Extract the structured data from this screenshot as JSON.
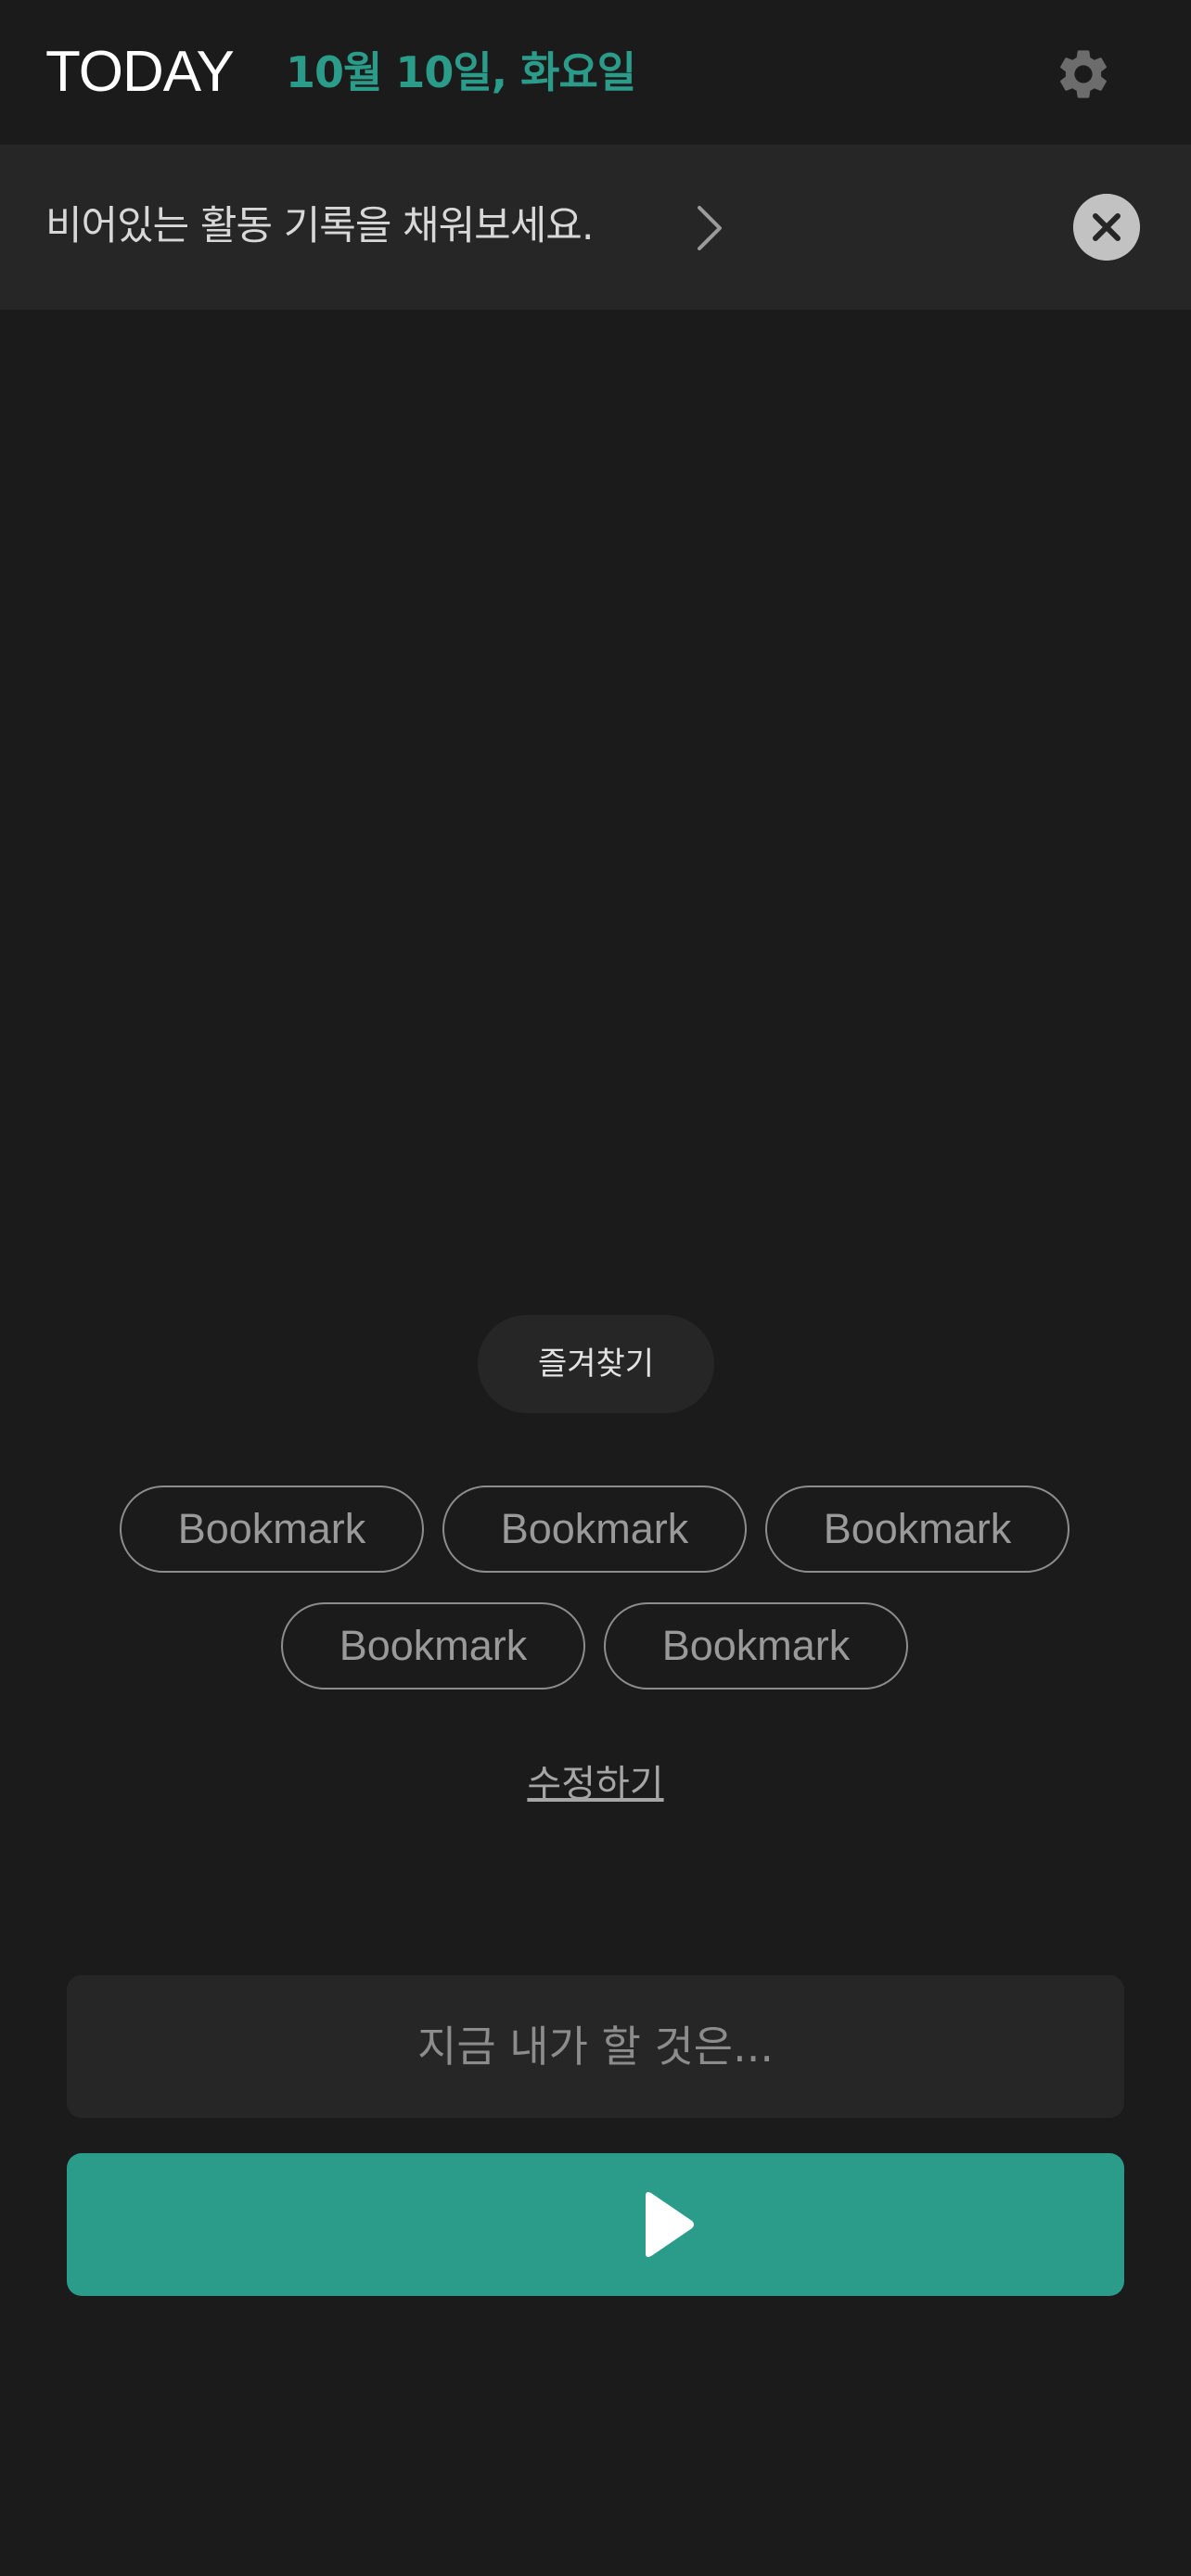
{
  "header": {
    "title": "TODAY",
    "date": "10월 10일, 화요일",
    "settings_icon": "gear-icon"
  },
  "banner": {
    "text": "비어있는 활동 기록을 채워보세요.",
    "chevron_icon": "chevron-right-icon",
    "close_icon": "close-icon"
  },
  "favorites": {
    "label": "즐겨찾기",
    "bookmarks": [
      "Bookmark",
      "Bookmark",
      "Bookmark",
      "Bookmark",
      "Bookmark"
    ],
    "edit_label": "수정하기"
  },
  "task": {
    "placeholder": "지금 내가 할 것은...",
    "play_icon": "play-icon"
  },
  "colors": {
    "background": "#1b1b1b",
    "surface": "#262626",
    "accent": "#2b9c89"
  }
}
